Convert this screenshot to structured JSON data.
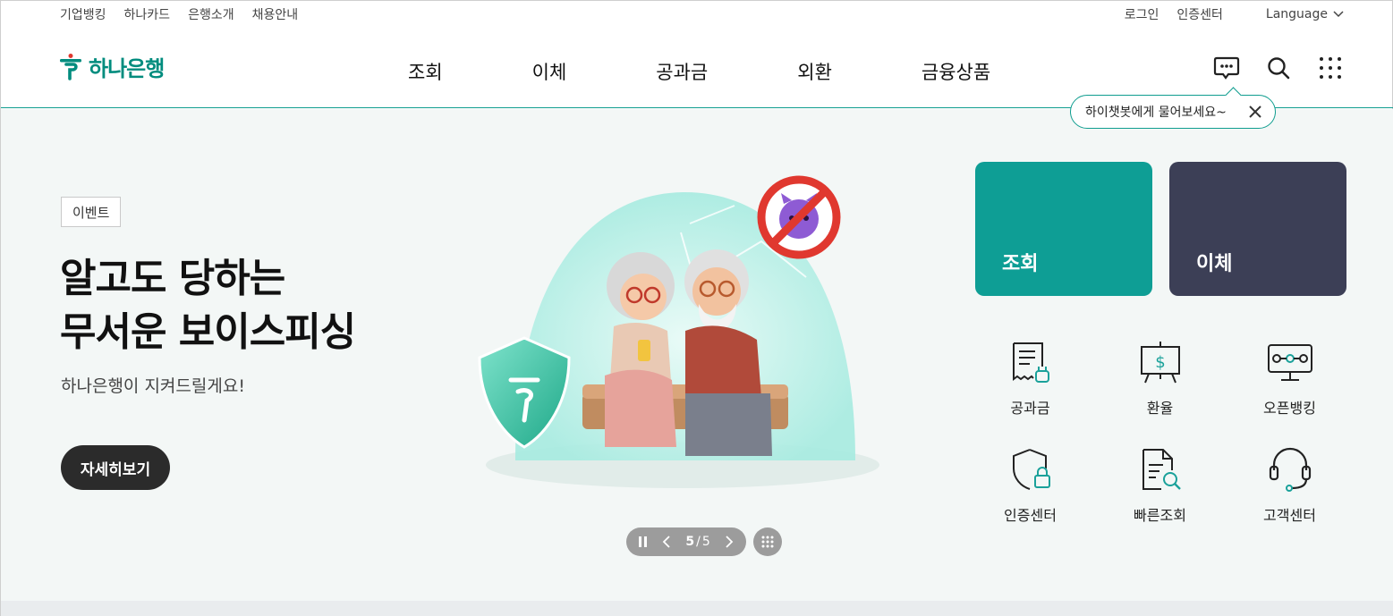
{
  "util": {
    "left_links": [
      "기업뱅킹",
      "하나카드",
      "은행소개",
      "채용안내"
    ],
    "right_links": [
      "로그인",
      "인증센터"
    ],
    "language": "Language"
  },
  "header": {
    "logo_text": "하나은행",
    "nav": [
      "조회",
      "이체",
      "공과금",
      "외환",
      "금융상품"
    ],
    "icons": [
      "chatbot-icon",
      "search-icon",
      "all-menu-icon"
    ],
    "chat_bubble": "하이챗봇에게 물어보세요~"
  },
  "hero": {
    "badge": "이벤트",
    "headline_line1": "알고도 당하는",
    "headline_line2": "무서운 보이스피싱",
    "subline": "하나은행이 지켜드릴게요!",
    "button": "자세히보기",
    "pager": {
      "current": "5",
      "separator": "/",
      "total": "5"
    }
  },
  "tiles": [
    {
      "label": "조회",
      "color": "#0e9e95"
    },
    {
      "label": "이체",
      "color": "#3c3f56"
    }
  ],
  "quick_menu": [
    {
      "label": "공과금",
      "icon": "bill-icon"
    },
    {
      "label": "환율",
      "icon": "exchange-board-icon"
    },
    {
      "label": "오픈뱅킹",
      "icon": "open-banking-icon"
    },
    {
      "label": "인증센터",
      "icon": "shield-lock-icon"
    },
    {
      "label": "빠른조회",
      "icon": "document-search-icon"
    },
    {
      "label": "고객센터",
      "icon": "headset-icon"
    }
  ],
  "colors": {
    "brand": "#008c7e",
    "accent_red": "#e0382f"
  }
}
